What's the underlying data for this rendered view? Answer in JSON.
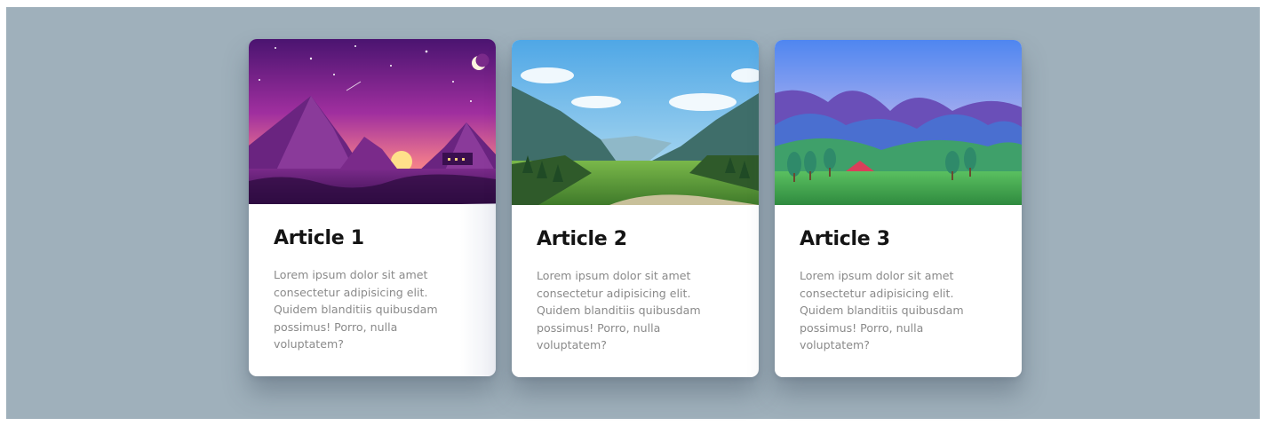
{
  "articles": [
    {
      "title": "Article 1",
      "excerpt": "Lorem ipsum dolor sit amet consectetur adipisicing elit. Quidem blanditiis quibusdam possimus! Porro, nulla voluptatem?",
      "image": "purple-night-mountain-illustration"
    },
    {
      "title": "Article 2",
      "excerpt": "Lorem ipsum dolor sit amet consectetur adipisicing elit. Quidem blanditiis quibusdam possimus! Porro, nulla voluptatem?",
      "image": "green-valley-mountain-illustration"
    },
    {
      "title": "Article 3",
      "excerpt": "Lorem ipsum dolor sit amet consectetur adipisicing elit. Quidem blanditiis quibusdam possimus! Porro, nulla voluptatem?",
      "image": "pastel-hills-camp-illustration"
    }
  ],
  "colors": {
    "background": "#9fb0bb",
    "card": "#ffffff",
    "title": "#141414",
    "excerpt": "#8a8a8a"
  }
}
